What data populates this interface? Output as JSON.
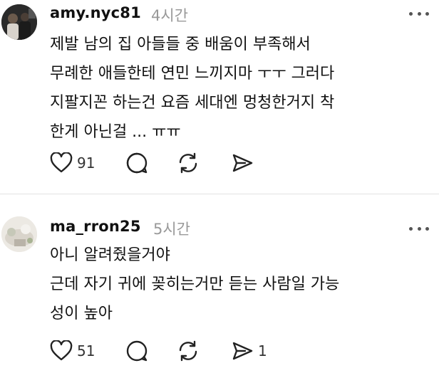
{
  "posts": [
    {
      "username": "amy.nyc81",
      "time": "4시간",
      "lines": [
        "제발 남의 집 아들들 중 배움이 부족해서",
        "무례한 애들한테 연민 느끼지마 ㅜㅜ 그러다",
        "지팔지꼰 하는건 요즘 세대엔 멍청한거지 착",
        "한게 아닌걸 ... ㅠㅠ"
      ],
      "likes": "91",
      "shares": ""
    },
    {
      "username": "ma_rron25",
      "time": "5시간",
      "lines": [
        "아니 알려줬을거야",
        "근데 자기 귀에 꽂히는거만 듣는 사람일 가능",
        "성이 높아"
      ],
      "likes": "51",
      "shares": "1"
    }
  ],
  "icons": {
    "like": "heart-icon",
    "comment": "comment-bubble-icon",
    "repost": "repost-icon",
    "share": "send-icon",
    "more": "more-options-icon"
  }
}
